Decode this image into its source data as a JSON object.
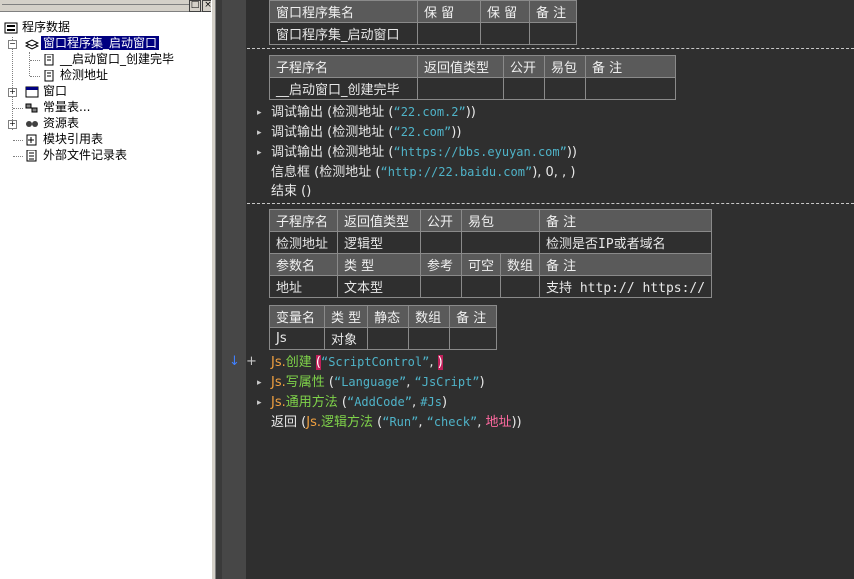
{
  "tree": {
    "root": "程序数据",
    "assembly": "窗口程序集_启动窗口",
    "sub1": "__启动窗口_创建完毕",
    "sub2": "检测地址",
    "window": "窗口",
    "constants": "常量表...",
    "resources": "资源表",
    "modules": "模块引用表",
    "external": "外部文件记录表"
  },
  "titlebar": {
    "btn1": "□",
    "btn2": "×"
  },
  "table1": {
    "h": [
      "窗口程序集名",
      "保 留",
      "保 留",
      "备 注"
    ],
    "r": [
      "窗口程序集_启动窗口",
      "",
      "",
      ""
    ]
  },
  "table2": {
    "h": [
      "子程序名",
      "返回值类型",
      "公开",
      "易包",
      "备 注"
    ],
    "r": [
      "__启动窗口_创建完毕",
      "",
      "",
      "",
      ""
    ]
  },
  "code1": [
    {
      "cmd": "调试输出",
      "fn": "检测地址",
      "arg": "“22.com.2”"
    },
    {
      "cmd": "调试输出",
      "fn": "检测地址",
      "arg": "“22.com”"
    },
    {
      "cmd": "调试输出",
      "fn": "检测地址",
      "arg": "“https://bbs.eyuyan.com”"
    },
    {
      "cmd": "信息框",
      "fn": "检测地址",
      "arg": "“http://22.baidu.com”",
      "rest": "), 0, , )"
    },
    {
      "cmd": "结束 ()"
    }
  ],
  "table3": {
    "h1": [
      "子程序名",
      "返回值类型",
      "公开",
      "易包",
      "备 注"
    ],
    "r1": [
      "检测地址",
      "逻辑型",
      "",
      "",
      "检测是否IP或者域名"
    ],
    "h2": [
      "参数名",
      "类 型",
      "参考",
      "可空",
      "数组",
      "备 注"
    ],
    "r2": [
      "地址",
      "文本型",
      "",
      "",
      "",
      "支持 http:// https://"
    ]
  },
  "table4": {
    "h": [
      "变量名",
      "类 型",
      "静态",
      "数组",
      "备 注"
    ],
    "r": [
      "Js",
      "对象",
      "",
      "",
      ""
    ]
  },
  "code2": {
    "l1_var": "Js.",
    "l1_m": "创建",
    "l1_arg": "“ScriptControl”",
    "l2_var": "Js.",
    "l2_m": "写属性",
    "l2_a1": "“Language”",
    "l2_a2": "“JsCript”",
    "l3_var": "Js.",
    "l3_m": "通用方法",
    "l3_a1": "“AddCode”",
    "l3_a2": "#Js",
    "l4_cmd": "返回",
    "l4_var": "Js.",
    "l4_m": "逻辑方法",
    "l4_a1": "“Run”",
    "l4_a2": "“check”",
    "l4_p": "地址"
  },
  "colors": {
    "string": "#4fb3c8",
    "method": "#7fd34a",
    "var": "#f0a040",
    "param": "#ff6aa0"
  }
}
